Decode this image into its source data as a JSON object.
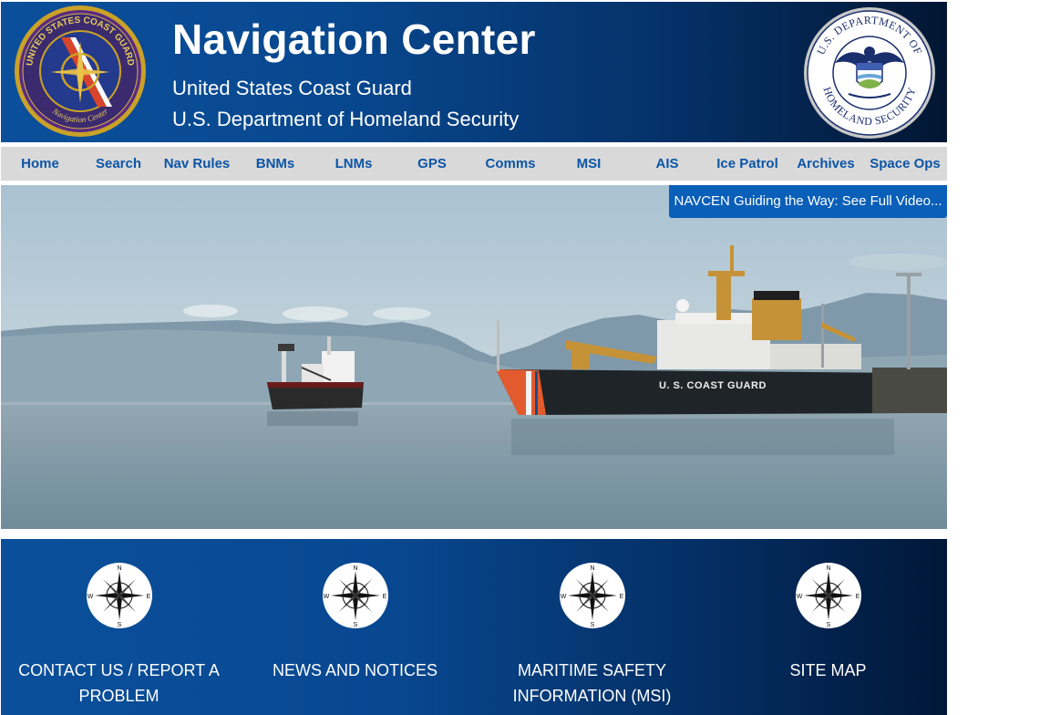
{
  "header": {
    "title": "Navigation Center",
    "subtitle_line1": "United States Coast Guard",
    "subtitle_line2": "U.S. Department of Homeland Security",
    "uscg_seal": {
      "icon": "uscg-navigation-center-seal-icon",
      "ring_text_top": "UNITED STATES COAST GUARD",
      "ring_text_bottom": "Navigation Center"
    },
    "dhs_seal": {
      "icon": "dhs-seal-icon",
      "ring_text_top": "U.S. DEPARTMENT OF",
      "ring_text_bottom": "HOMELAND SECURITY"
    }
  },
  "nav": {
    "items": [
      {
        "label": "Home"
      },
      {
        "label": "Search"
      },
      {
        "label": "Nav Rules"
      },
      {
        "label": "BNMs"
      },
      {
        "label": "LNMs"
      },
      {
        "label": "GPS"
      },
      {
        "label": "Comms"
      },
      {
        "label": "MSI"
      },
      {
        "label": "AIS"
      },
      {
        "label": "Ice Patrol"
      },
      {
        "label": "Archives"
      },
      {
        "label": "Space Ops"
      }
    ]
  },
  "hero": {
    "video_link": "NAVCEN Guiding the Way: See Full Video...",
    "ship_hull_text": "U. S. COAST GUARD"
  },
  "tiles": [
    {
      "label": "CONTACT US / REPORT A PROBLEM",
      "icon": "compass-rose-icon"
    },
    {
      "label": "NEWS AND NOTICES",
      "icon": "compass-rose-icon"
    },
    {
      "label": "MARITIME SAFETY INFORMATION (MSI)",
      "icon": "compass-rose-icon"
    },
    {
      "label": "SITE MAP",
      "icon": "compass-rose-icon"
    }
  ],
  "compass_letters": {
    "n": "N",
    "s": "S",
    "e": "E",
    "w": "W"
  },
  "colors": {
    "header_start": "#0b4f9b",
    "header_end": "#021632",
    "nav_bg": "#d9d9d9",
    "nav_text": "#0b55a6",
    "video_link_bg": "#0a5fb8"
  }
}
